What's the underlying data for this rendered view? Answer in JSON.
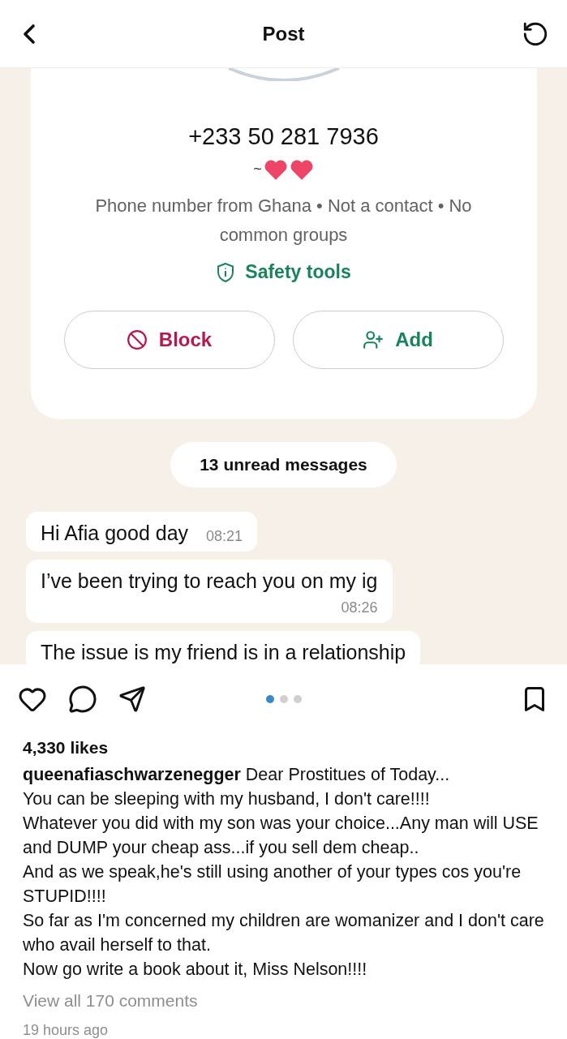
{
  "header": {
    "title": "Post"
  },
  "chat": {
    "phone": "+233 50 281 7936",
    "about": "~",
    "info": "Phone number from Ghana • Not a contact • No common groups",
    "safety_link": "Safety tools",
    "buttons": [
      {
        "kind": "block",
        "label": "Block"
      },
      {
        "kind": "add",
        "label": "Add"
      }
    ],
    "unread_label": "13 unread messages",
    "messages": [
      {
        "text": "Hi Afia good day",
        "time": "08:21",
        "inline_time": true
      },
      {
        "text": "I’ve been trying to reach you on my ig",
        "time": "08:26",
        "inline_time": false
      },
      {
        "text": "The issue is my friend is in a relationship"
      }
    ]
  },
  "carousel_dots": [
    {
      "selected": true
    },
    {
      "selected": false
    },
    {
      "selected": false
    }
  ],
  "likes": "4,330 likes",
  "caption": "**queenafiaschwarzenegger** Dear Prostitues of Today...\nYou can be sleeping with my husband, I don't care!!!!\nWhatever you did with my son was your choice...Any man will USE and DUMP your cheap ass...if you sell dem cheap..\nAnd as we speak,he's still using another of your types cos you're STUPID!!!!\nSo far as I'm concerned my children are womanizer and I don't care who avail herself to that.\nNow go write a book about it, Miss Nelson!!!!",
  "comments_link": "View all 170 comments",
  "time_ago": "19 hours ago"
}
